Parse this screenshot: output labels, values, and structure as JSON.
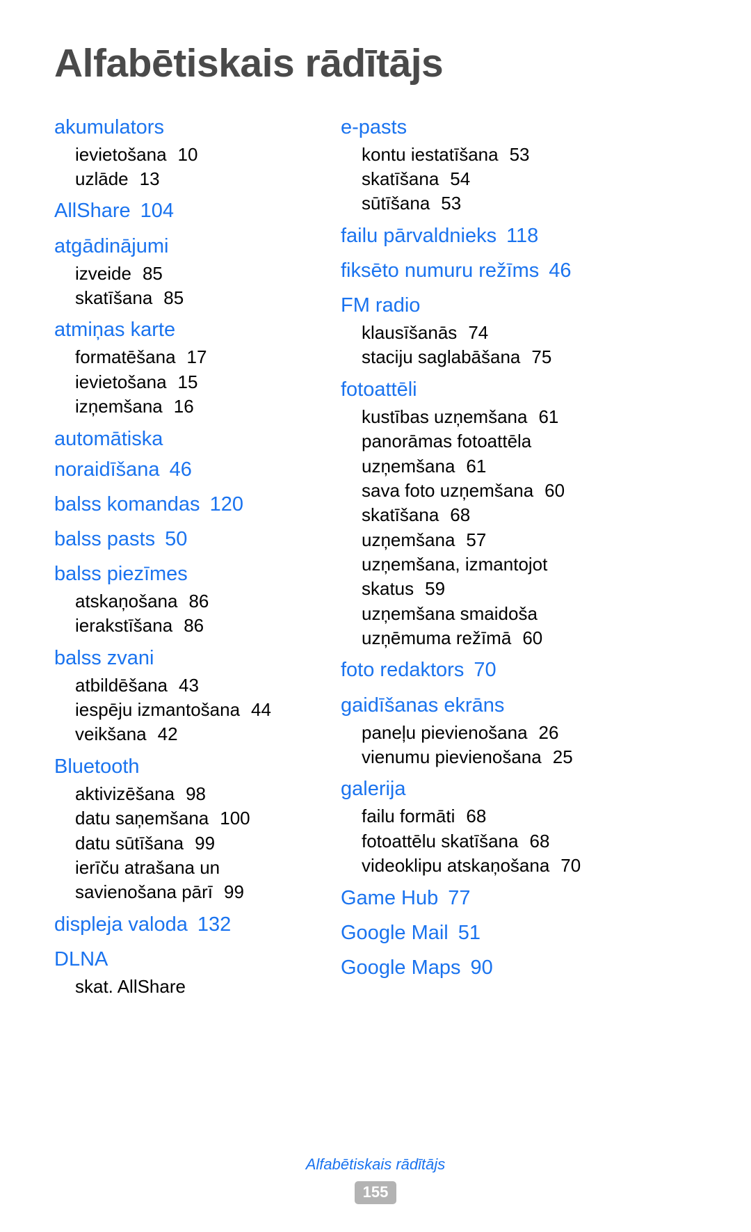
{
  "document": {
    "title": "Alfabētiskais rādītājs",
    "heading_color": "#1a73ef",
    "title_color": "#4a4a4a",
    "body_color": "#000000"
  },
  "columns": {
    "left": [
      {
        "heading": "akumulators",
        "heading_page": "",
        "subentries": [
          {
            "label": "ievietošana",
            "page": "10"
          },
          {
            "label": "uzlāde",
            "page": "13"
          }
        ]
      },
      {
        "heading": "AllShare",
        "heading_page": "104",
        "subentries": []
      },
      {
        "heading": "atgādinājumi",
        "heading_page": "",
        "subentries": [
          {
            "label": "izveide",
            "page": "85"
          },
          {
            "label": "skatīšana",
            "page": "85"
          }
        ]
      },
      {
        "heading": "atmiņas karte",
        "heading_page": "",
        "subentries": [
          {
            "label": "formatēšana",
            "page": "17"
          },
          {
            "label": "ievietošana",
            "page": "15"
          },
          {
            "label": "izņemšana",
            "page": "16"
          }
        ]
      },
      {
        "heading": "automātiska",
        "heading_line2": "noraidīšana",
        "heading_page": "46",
        "subentries": []
      },
      {
        "heading": "balss komandas",
        "heading_page": "120",
        "subentries": []
      },
      {
        "heading": "balss pasts",
        "heading_page": "50",
        "subentries": []
      },
      {
        "heading": "balss piezīmes",
        "heading_page": "",
        "subentries": [
          {
            "label": "atskaņošana",
            "page": "86"
          },
          {
            "label": "ierakstīšana",
            "page": "86"
          }
        ]
      },
      {
        "heading": "balss zvani",
        "heading_page": "",
        "subentries": [
          {
            "label": "atbildēšana",
            "page": "43"
          },
          {
            "label": "iespēju izmantošana",
            "page": "44"
          },
          {
            "label": "veikšana",
            "page": "42"
          }
        ]
      },
      {
        "heading": "Bluetooth",
        "heading_page": "",
        "subentries": [
          {
            "label": "aktivizēšana",
            "page": "98"
          },
          {
            "label": "datu saņemšana",
            "page": "100"
          },
          {
            "label": "datu sūtīšana",
            "page": "99"
          },
          {
            "label": "ierīču atrašana un",
            "page": ""
          },
          {
            "label": "savienošana pārī",
            "page": "99"
          }
        ]
      },
      {
        "heading": "displeja valoda",
        "heading_page": "132",
        "subentries": []
      },
      {
        "heading": "DLNA",
        "heading_page": "",
        "subentries": [
          {
            "label": "skat. AllShare",
            "page": ""
          }
        ]
      }
    ],
    "right": [
      {
        "heading": "e-pasts",
        "heading_page": "",
        "subentries": [
          {
            "label": "kontu iestatīšana",
            "page": "53"
          },
          {
            "label": "skatīšana",
            "page": "54"
          },
          {
            "label": "sūtīšana",
            "page": "53"
          }
        ]
      },
      {
        "heading": "failu pārvaldnieks",
        "heading_page": "118",
        "subentries": []
      },
      {
        "heading": "fiksēto numuru režīms",
        "heading_page": "46",
        "subentries": []
      },
      {
        "heading": "FM radio",
        "heading_page": "",
        "subentries": [
          {
            "label": "klausīšanās",
            "page": "74"
          },
          {
            "label": "staciju saglabāšana",
            "page": "75"
          }
        ]
      },
      {
        "heading": "fotoattēli",
        "heading_page": "",
        "subentries": [
          {
            "label": "kustības uzņemšana",
            "page": "61"
          },
          {
            "label": "panorāmas fotoattēla",
            "page": ""
          },
          {
            "label": "uzņemšana",
            "page": "61"
          },
          {
            "label": "sava foto uzņemšana",
            "page": "60"
          },
          {
            "label": "skatīšana",
            "page": "68"
          },
          {
            "label": "uzņemšana",
            "page": "57"
          },
          {
            "label": "uzņemšana, izmantojot",
            "page": ""
          },
          {
            "label": "skatus",
            "page": "59"
          },
          {
            "label": "uzņemšana smaidoša",
            "page": ""
          },
          {
            "label": "uzņēmuma režīmā",
            "page": "60"
          }
        ]
      },
      {
        "heading": "foto redaktors",
        "heading_page": "70",
        "subentries": []
      },
      {
        "heading": "gaidīšanas ekrāns",
        "heading_page": "",
        "subentries": [
          {
            "label": "paneļu pievienošana",
            "page": "26"
          },
          {
            "label": "vienumu pievienošana",
            "page": "25"
          }
        ]
      },
      {
        "heading": "galerija",
        "heading_page": "",
        "subentries": [
          {
            "label": "failu formāti",
            "page": "68"
          },
          {
            "label": "fotoattēlu skatīšana",
            "page": "68"
          },
          {
            "label": "videoklipu atskaņošana",
            "page": "70"
          }
        ]
      },
      {
        "heading": "Game Hub",
        "heading_page": "77",
        "subentries": []
      },
      {
        "heading": "Google Mail",
        "heading_page": "51",
        "subentries": []
      },
      {
        "heading": "Google Maps",
        "heading_page": "90",
        "subentries": []
      }
    ]
  },
  "footer": {
    "title": "Alfabētiskais rādītājs",
    "page_number": "155"
  }
}
